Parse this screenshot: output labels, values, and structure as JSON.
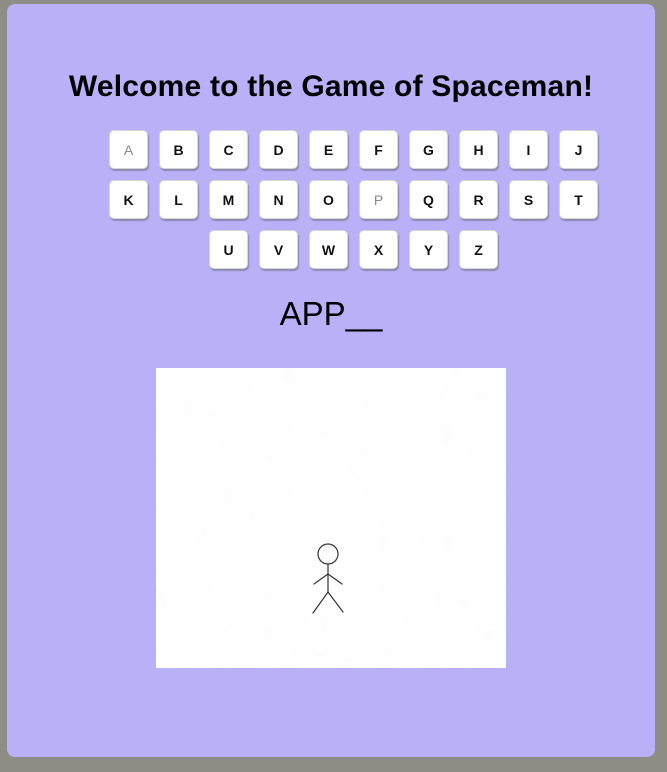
{
  "game": {
    "title": "Welcome to the Game of Spaceman!",
    "word_display": "APP__"
  },
  "keyboard": {
    "rows": [
      [
        {
          "letter": "A",
          "used": true
        },
        {
          "letter": "B",
          "used": false
        },
        {
          "letter": "C",
          "used": false
        },
        {
          "letter": "D",
          "used": false
        },
        {
          "letter": "E",
          "used": false
        },
        {
          "letter": "F",
          "used": false
        },
        {
          "letter": "G",
          "used": false
        },
        {
          "letter": "H",
          "used": false
        },
        {
          "letter": "I",
          "used": false
        },
        {
          "letter": "J",
          "used": false
        }
      ],
      [
        {
          "letter": "K",
          "used": false
        },
        {
          "letter": "L",
          "used": false
        },
        {
          "letter": "M",
          "used": false
        },
        {
          "letter": "N",
          "used": false
        },
        {
          "letter": "O",
          "used": false
        },
        {
          "letter": "P",
          "used": true
        },
        {
          "letter": "Q",
          "used": false
        },
        {
          "letter": "R",
          "used": false
        },
        {
          "letter": "S",
          "used": false
        },
        {
          "letter": "T",
          "used": false
        }
      ],
      [
        {
          "letter": "U",
          "used": false
        },
        {
          "letter": "V",
          "used": false
        },
        {
          "letter": "W",
          "used": false
        },
        {
          "letter": "X",
          "used": false
        },
        {
          "letter": "Y",
          "used": false
        },
        {
          "letter": "Z",
          "used": false
        }
      ]
    ]
  },
  "drawing": {
    "figure_icon": "stick-figure",
    "stroke_color": "#333333"
  },
  "colors": {
    "panel_background": "#b9b0f8",
    "page_background": "#8e8d86",
    "used_key_text": "#8a8a8a"
  }
}
